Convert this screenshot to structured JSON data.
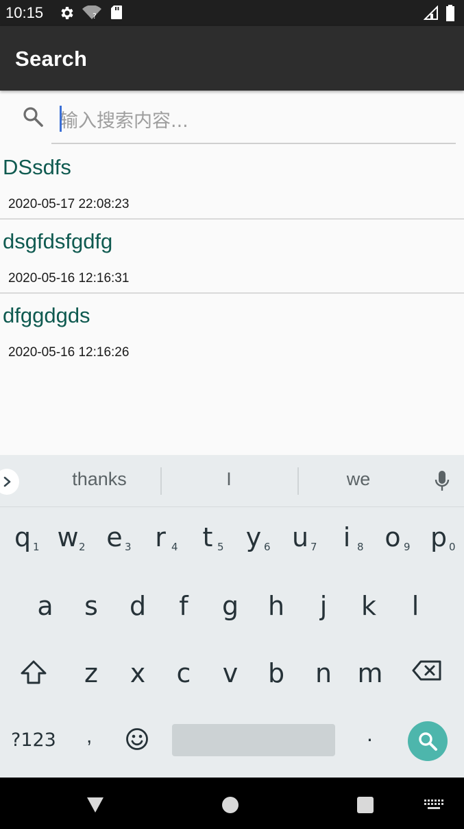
{
  "status_bar": {
    "time": "10:15"
  },
  "app_bar": {
    "title": "Search"
  },
  "search": {
    "placeholder": "输入搜索内容...",
    "value": ""
  },
  "results": [
    {
      "title": "DSsdfs",
      "timestamp": "2020-05-17 22:08:23"
    },
    {
      "title": "dsgfdsfgdfg",
      "timestamp": "2020-05-16 12:16:31"
    },
    {
      "title": "dfggdgds",
      "timestamp": "2020-05-16 12:16:26"
    }
  ],
  "keyboard": {
    "suggestions": [
      "thanks",
      "I",
      "we"
    ],
    "row1": [
      {
        "key": "q",
        "hint": "1"
      },
      {
        "key": "w",
        "hint": "2"
      },
      {
        "key": "e",
        "hint": "3"
      },
      {
        "key": "r",
        "hint": "4"
      },
      {
        "key": "t",
        "hint": "5"
      },
      {
        "key": "y",
        "hint": "6"
      },
      {
        "key": "u",
        "hint": "7"
      },
      {
        "key": "i",
        "hint": "8"
      },
      {
        "key": "o",
        "hint": "9"
      },
      {
        "key": "p",
        "hint": "0"
      }
    ],
    "row2": [
      "a",
      "s",
      "d",
      "f",
      "g",
      "h",
      "j",
      "k",
      "l"
    ],
    "row3": [
      "z",
      "x",
      "c",
      "v",
      "b",
      "n",
      "m"
    ],
    "symbols_label": "?123",
    "comma": ",",
    "period": ".",
    "action": "search-icon"
  },
  "colors": {
    "app_bar": "#2d2d2d",
    "title_text": "#0f5a50",
    "action_key": "#4db6ac",
    "caret": "#3b6fd6"
  }
}
